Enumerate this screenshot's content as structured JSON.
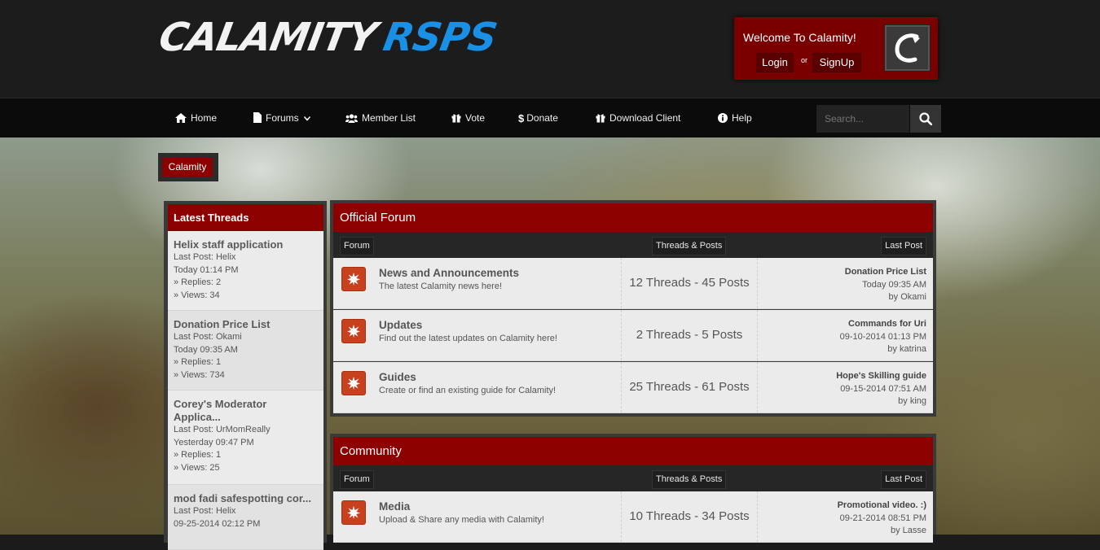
{
  "header": {
    "logo_part1": "CALAMITY",
    "logo_part2": "RSPS",
    "welcome_text": "Welcome To Calamity!",
    "login_label": "Login",
    "or_text": "or",
    "signup_label": "SignUp"
  },
  "nav": {
    "items": [
      {
        "label": "Home",
        "icon": "home-icon"
      },
      {
        "label": "Forums",
        "icon": "file-icon"
      },
      {
        "label": "Member List",
        "icon": "users-icon"
      },
      {
        "label": "Vote",
        "icon": "gift-icon"
      },
      {
        "label": "Donate",
        "icon": "dollar-icon"
      },
      {
        "label": "Download Client",
        "icon": "gift-icon"
      },
      {
        "label": "Help",
        "icon": "info-icon"
      }
    ],
    "search_placeholder": "Search..."
  },
  "breadcrumb": {
    "label": "Calamity"
  },
  "sidebar": {
    "title": "Latest Threads",
    "threads": [
      {
        "title": "Helix staff application",
        "last_post": "Last Post: Helix",
        "time": "Today 01:14 PM",
        "replies": "» Replies: 2",
        "views": "» Views: 34"
      },
      {
        "title": "Donation Price List",
        "last_post": "Last Post: Okami",
        "time": "Today 09:35 AM",
        "replies": "» Replies: 1",
        "views": "» Views: 734"
      },
      {
        "title": "Corey's Moderator Applica...",
        "last_post": "Last Post: UrMomReally",
        "time": "Yesterday 09:47 PM",
        "replies": "» Replies: 1",
        "views": "» Views: 25"
      },
      {
        "title": "mod fadi safespotting cor...",
        "last_post": "Last Post: Helix",
        "time": "09-25-2014 02:12 PM",
        "replies": "",
        "views": ""
      }
    ]
  },
  "columns": {
    "forum": "Forum",
    "threads_posts": "Threads & Posts",
    "last_post": "Last Post"
  },
  "sections": [
    {
      "title": "Official Forum",
      "forums": [
        {
          "name": "News and Announcements",
          "desc": "The latest Calamity news here!",
          "counts": "12 Threads -  45 Posts",
          "lp_title": "Donation Price List",
          "lp_time": "Today 09:35 AM",
          "lp_by": "by Okami"
        },
        {
          "name": "Updates",
          "desc": "Find out the latest updates on Calamity here!",
          "counts": "2 Threads -  5 Posts",
          "lp_title": "Commands for Uri",
          "lp_time": "09-10-2014 01:13 PM",
          "lp_by": "by katrina"
        },
        {
          "name": "Guides",
          "desc": "Create or find an existing guide for Calamity!",
          "counts": "25 Threads -  61 Posts",
          "lp_title": "Hope's Skilling guide",
          "lp_time": "09-15-2014 07:51 AM",
          "lp_by": "by king"
        }
      ]
    },
    {
      "title": "Community",
      "forums": [
        {
          "name": "Media",
          "desc": "Upload & Share any media with Calamity!",
          "counts": "10 Threads -  34 Posts",
          "lp_title": "Promotional video. :)",
          "lp_time": "09-21-2014 08:51 PM",
          "lp_by": "by Lasse"
        }
      ]
    }
  ],
  "colors": {
    "accent_red": "#8c0000",
    "welcome_red": "#7a0000",
    "logo_blue": "#1a8fe6",
    "forum_icon": "#c8411e"
  }
}
